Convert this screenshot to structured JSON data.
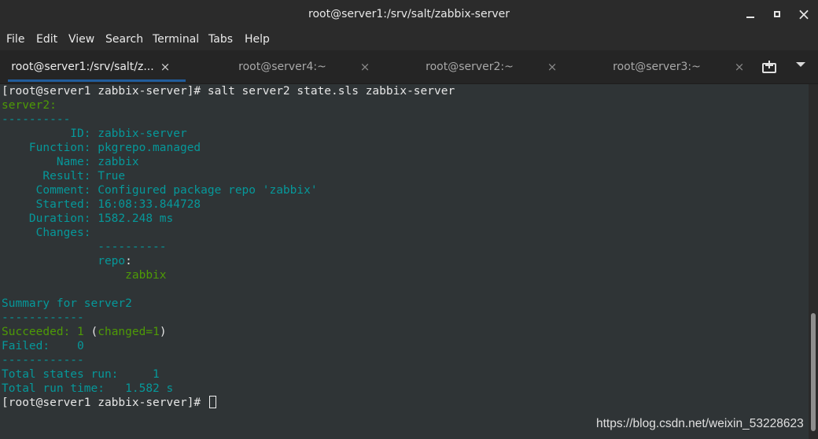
{
  "window": {
    "title": "root@server1:/srv/salt/zabbix-server",
    "controls": {
      "minimize_icon": "minimize-icon",
      "maximize_icon": "maximize-icon",
      "close_label": "×"
    }
  },
  "menu": [
    "File",
    "Edit",
    "View",
    "Search",
    "Terminal",
    "Tabs",
    "Help"
  ],
  "tabs": [
    {
      "label": "root@server1:/srv/salt/z...",
      "close": "×",
      "active": true
    },
    {
      "label": "root@server4:~",
      "close": "×",
      "active": false
    },
    {
      "label": "root@server2:~",
      "close": "×",
      "active": false
    },
    {
      "label": "root@server3:~",
      "close": "×",
      "active": false
    }
  ],
  "colors": {
    "green": "#4e9a06",
    "cyan": "#06989a",
    "text": "#e6e6e6",
    "background": "#2f3436",
    "accent": "#215d9c"
  },
  "terminal": {
    "prompt": "[root@server1 zabbix-server]# ",
    "command": "salt server2 state.sls zabbix-server",
    "host": "server2:",
    "sep10": "----------",
    "sep12": "------------",
    "id_key": "          ID: ",
    "id_val": "zabbix-server",
    "function_key": "    Function: ",
    "function_val": "pkgrepo.managed",
    "name_key": "        Name: ",
    "name_val": "zabbix",
    "result_key": "      Result: ",
    "result_val": "True",
    "comment_key": "     Comment: ",
    "comment_val": "Configured package repo 'zabbix'",
    "started_key": "     Started: ",
    "started_val": "16:08:33.844728",
    "duration_key": "    Duration: ",
    "duration_val": "1582.248 ms",
    "changes_key": "     Changes: ",
    "changes_sep": "              ----------",
    "repo_indent": "              ",
    "repo_key": "repo",
    "colon": ":",
    "repo_value": "                  zabbix",
    "summary": "Summary for server2",
    "succeeded_label": "Succeeded: 1",
    "open_paren": " (",
    "changed": "changed=1",
    "close_paren": ")",
    "failed": "Failed:    0",
    "total_states": "Total states run:     1",
    "total_time": "Total run time:   1.582 s",
    "final_prompt": "[root@server1 zabbix-server]# "
  },
  "watermark": "https://blog.csdn.net/weixin_53228623"
}
